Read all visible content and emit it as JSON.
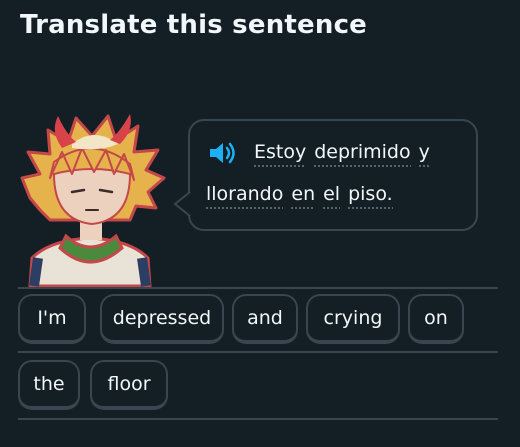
{
  "header": {
    "title": "Translate this sentence"
  },
  "prompt": {
    "speaker_icon": "speaker-icon",
    "line1": [
      "Estoy",
      "deprimido",
      "y"
    ],
    "line2": [
      "llorando",
      "en",
      "el",
      "piso."
    ]
  },
  "word_bank": {
    "row1": [
      "I'm",
      "depressed",
      "and",
      "crying",
      "on"
    ],
    "row2": [
      "the",
      "floor"
    ]
  },
  "colors": {
    "background": "#131f24",
    "border": "#37464f",
    "text": "#f1f7fb",
    "speaker": "#1cb0f6"
  }
}
